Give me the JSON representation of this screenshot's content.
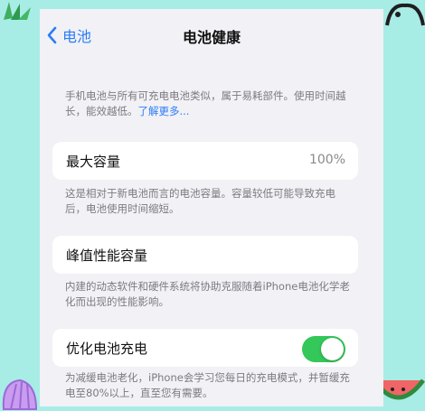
{
  "nav": {
    "back_label": "电池",
    "title": "电池健康"
  },
  "intro": {
    "text": "手机电池与所有可充电电池类似，属于易耗部件。使用时间越长，能效越低。",
    "link": "了解更多..."
  },
  "max_capacity": {
    "label": "最大容量",
    "value": "100%",
    "note": "这是相对于新电池而言的电池容量。容量较低可能导致充电后，电池使用时间缩短。"
  },
  "peak_performance": {
    "label": "峰值性能容量",
    "note": "内建的动态软件和硬件系统将协助克服随着iPhone电池化学老化而出现的性能影响。"
  },
  "optimized_charging": {
    "label": "优化电池充电",
    "enabled": true,
    "note": "为减缓电池老化，iPhone会学习您每日的充电模式，并暂缓充电至80%以上，直至您有需要。"
  },
  "colors": {
    "accent": "#2d7cf6",
    "toggle_on": "#34c759",
    "background": "#f1f1f6",
    "outer_background": "#a8ece6"
  },
  "icons": {
    "back": "chevron-left-icon"
  }
}
